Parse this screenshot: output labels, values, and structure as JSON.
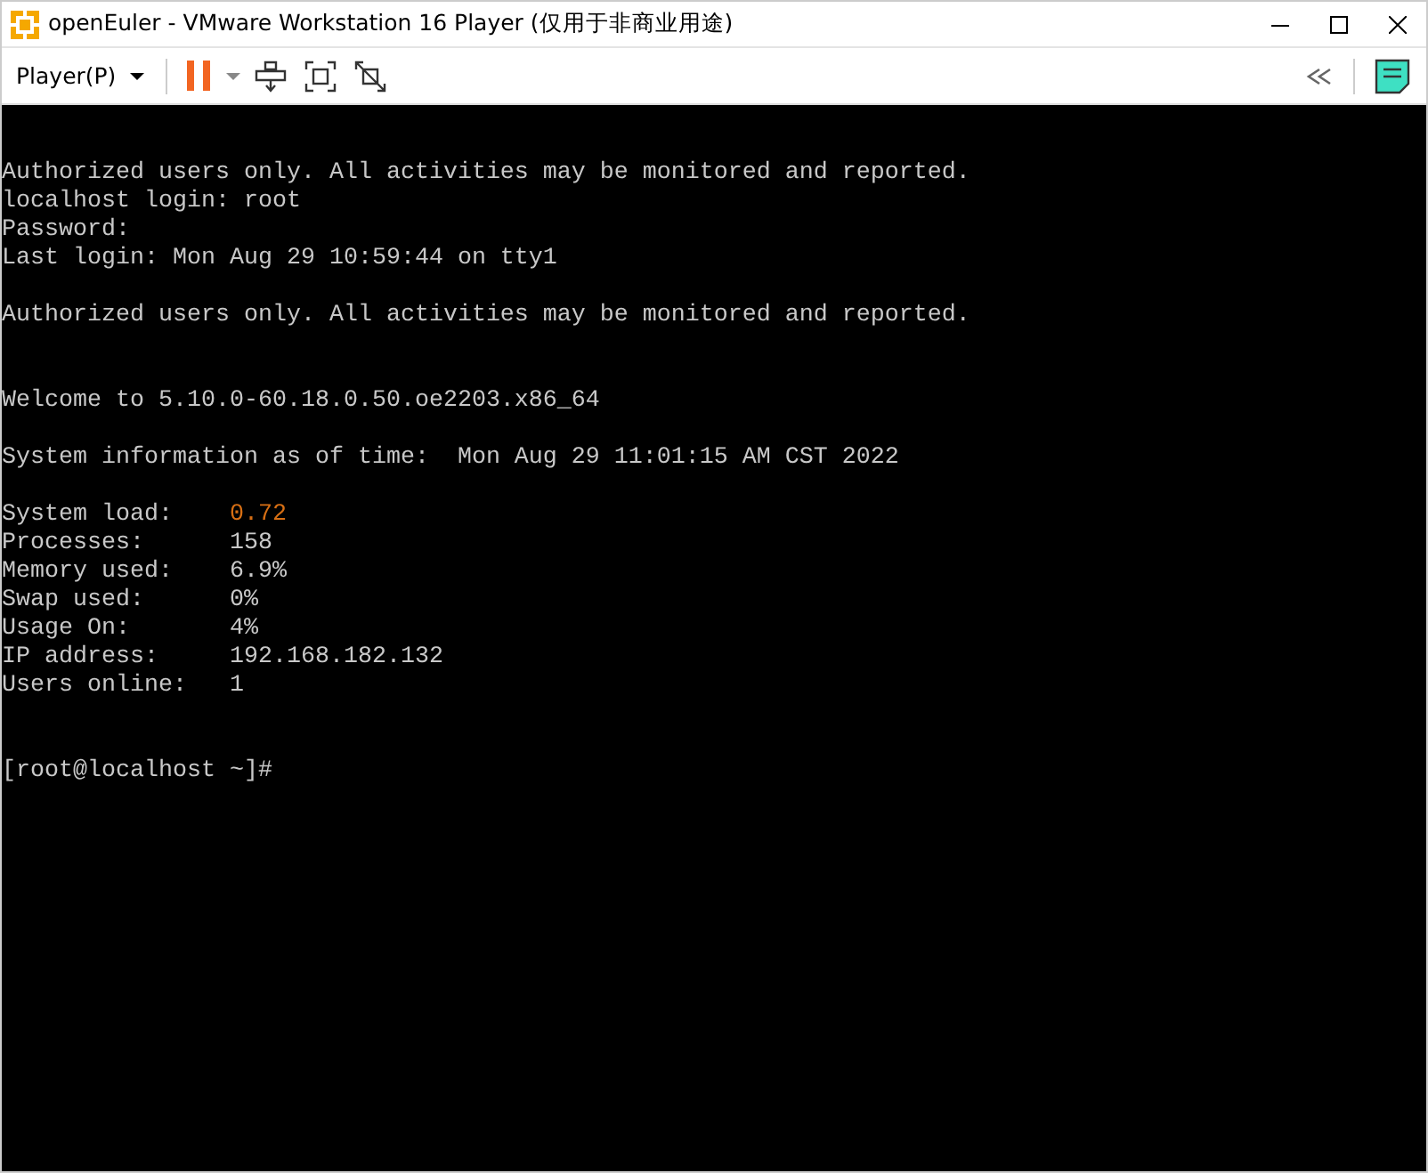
{
  "window": {
    "title": "openEuler - VMware Workstation 16 Player (仅用于非商业用途)"
  },
  "toolbar": {
    "menu_label": "Player(P)"
  },
  "terminal": {
    "lines": [
      {
        "kind": "text",
        "text": "Authorized users only. All activities may be monitored and reported."
      },
      {
        "kind": "text",
        "text": "localhost login: root"
      },
      {
        "kind": "text",
        "text": "Password:"
      },
      {
        "kind": "text",
        "text": "Last login: Mon Aug 29 10:59:44 on tty1"
      },
      {
        "kind": "blank"
      },
      {
        "kind": "text",
        "text": "Authorized users only. All activities may be monitored and reported."
      },
      {
        "kind": "blank"
      },
      {
        "kind": "blank"
      },
      {
        "kind": "text",
        "text": "Welcome to 5.10.0-60.18.0.50.oe2203.x86_64"
      },
      {
        "kind": "blank"
      },
      {
        "kind": "text",
        "text": "System information as of time:  Mon Aug 29 11:01:15 AM CST 2022"
      },
      {
        "kind": "blank"
      },
      {
        "kind": "stat",
        "label": "System load:",
        "value": "0.72",
        "highlight": true
      },
      {
        "kind": "stat",
        "label": "Processes:",
        "value": "158",
        "highlight": false
      },
      {
        "kind": "stat",
        "label": "Memory used:",
        "value": "6.9%",
        "highlight": false
      },
      {
        "kind": "stat",
        "label": "Swap used:",
        "value": "0%",
        "highlight": false
      },
      {
        "kind": "stat",
        "label": "Usage On:",
        "value": "4%",
        "highlight": false
      },
      {
        "kind": "stat",
        "label": "IP address:",
        "value": "192.168.182.132",
        "highlight": false
      },
      {
        "kind": "stat",
        "label": "Users online:",
        "value": "1",
        "highlight": false
      },
      {
        "kind": "blank"
      },
      {
        "kind": "blank"
      },
      {
        "kind": "text",
        "text": "[root@localhost ~]#"
      }
    ]
  }
}
